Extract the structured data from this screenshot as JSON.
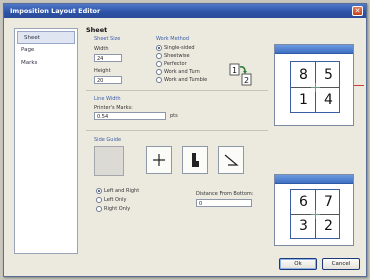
{
  "window": {
    "title": "Imposition Layout Editor"
  },
  "nav": {
    "items": [
      "Sheet",
      "Page",
      "Marks"
    ]
  },
  "sheet": {
    "heading": "Sheet",
    "sheet_size": {
      "group": "Sheet Size",
      "width_label": "Width",
      "width_value": "24",
      "height_label": "Height",
      "height_value": "20"
    },
    "work_method": {
      "group": "Work Method",
      "options": [
        "Single-sided",
        "Sheetwise",
        "Perfector",
        "Work and Turn",
        "Work and Tumble"
      ],
      "selected_index": 0
    },
    "line_width": {
      "group": "Line Width",
      "label": "Printer's Marks:",
      "value": "0.54",
      "unit": "pts"
    },
    "side_guide": {
      "group": "Side Guide",
      "options": [
        "Left and Right",
        "Left Only",
        "Right Only"
      ],
      "selected_index": 0,
      "distance_label": "Distance From Bottom:",
      "distance_value": "0"
    }
  },
  "preview": {
    "top_numbers": [
      "8",
      "5",
      "1",
      "4"
    ],
    "bottom_numbers": [
      "6",
      "7",
      "3",
      "2"
    ],
    "page_badge_front": "1",
    "page_badge_back": "2"
  },
  "buttons": {
    "ok_label": "Ok",
    "cancel_label": "Cancel"
  },
  "colors": {
    "title_bar": "#2c52a6",
    "group_title": "#3d5fa6",
    "accent_red": "#cc3b3b"
  }
}
